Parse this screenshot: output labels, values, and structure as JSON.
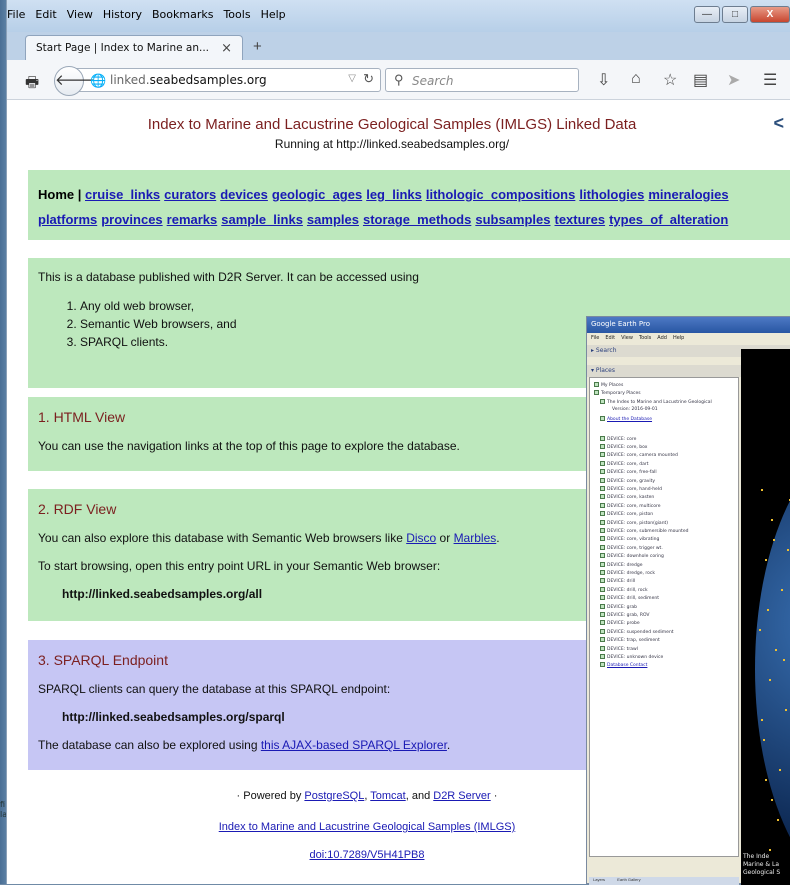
{
  "desktop": {
    "left_text_1": "fi",
    "left_text_2": "la"
  },
  "menubar": {
    "items": [
      "File",
      "Edit",
      "View",
      "History",
      "Bookmarks",
      "Tools",
      "Help"
    ],
    "accel": [
      "F",
      "E",
      "V",
      "s",
      "B",
      "T",
      "H"
    ]
  },
  "window_controls": {
    "minimize": "—",
    "maximize": "□",
    "close": "X"
  },
  "tab": {
    "label": "Start Page | Index to Marine an...",
    "close": "×",
    "new": "+"
  },
  "navbar": {
    "url_prefix": "linked.",
    "url_domain": "seabedsamples.org",
    "search_placeholder": "Search"
  },
  "icons": {
    "print": "print-icon",
    "back": "back-arrow-icon",
    "globe": "globe-icon",
    "search": "search-icon",
    "download": "download-icon",
    "home": "home-icon",
    "star": "star-icon",
    "reader": "reader-icon",
    "send": "send-icon",
    "menu": "menu-icon",
    "share": "share-icon"
  },
  "page": {
    "title": "Index to Marine and Lacustrine Geological Samples (IMLGS) Linked Data",
    "subtitle": "Running at http://linked.seabedsamples.org/",
    "nav_home": "Home",
    "nav_links": [
      "cruise_links",
      "curators",
      "devices",
      "geologic_ages",
      "leg_links",
      "lithologic_compositions",
      "lithologies",
      "mineralogies",
      "platforms",
      "provinces",
      "remarks",
      "sample_links",
      "samples",
      "storage_methods",
      "subsamples",
      "textures",
      "types_of_alteration"
    ],
    "intro_text": "This is a database published with D2R Server. It can be accessed using",
    "intro_list": [
      "Any old web browser,",
      "Semantic Web browsers, and",
      "SPARQL clients."
    ],
    "html_view": {
      "heading": "1. HTML View",
      "text": "You can use the navigation links at the top of this page to explore the database."
    },
    "rdf_view": {
      "heading": "2. RDF View",
      "text_before": "You can also explore this database with Semantic Web browsers like ",
      "link1": "Disco",
      "text_mid": " or ",
      "link2": "Marbles",
      "text_after": ".",
      "text2": "To start browsing, open this entry point URL in your Semantic Web browser:",
      "url": "http://linked.seabedsamples.org/all"
    },
    "sparql": {
      "heading": "3. SPARQL Endpoint",
      "text": "SPARQL clients can query the database at this SPARQL endpoint:",
      "url": "http://linked.seabedsamples.org/sparql",
      "text2_before": "The database can also be explored using ",
      "link": "this AJAX-based SPARQL Explorer",
      "text2_after": "."
    },
    "footer": {
      "powered_prefix": "· Powered by ",
      "pg": "PostgreSQL",
      "sep1": ", ",
      "tomcat": "Tomcat",
      "sep2": ", and ",
      "d2r": "D2R Server",
      "powered_suffix": " ·",
      "imlgs": "Index to Marine and Lacustrine Geological Samples (IMLGS)",
      "doi": "doi:10.7289/V5H41PB8"
    }
  },
  "google_earth": {
    "title": "Google Earth Pro",
    "menu": [
      "File",
      "Edit",
      "View",
      "Tools",
      "Add",
      "Help"
    ],
    "search_label": "Search",
    "places_label": "Places",
    "items": [
      "My Places",
      "Temporary Places",
      "The Index to Marine and Lacustrine Geological",
      "Version: 2016-09-01",
      "About the Database",
      "DEVICE: core",
      "DEVICE: core, box",
      "DEVICE: core, camera mounted",
      "DEVICE: core, dart",
      "DEVICE: core, free-fall",
      "DEVICE: core, gravity",
      "DEVICE: core, hand-held",
      "DEVICE: core, kasten",
      "DEVICE: core, multicore",
      "DEVICE: core, piston",
      "DEVICE: core, piston(giant)",
      "DEVICE: core, submersible mounted",
      "DEVICE: core, vibrating",
      "DEVICE: core, trigger wt.",
      "DEVICE: downhole coring",
      "DEVICE: dredge",
      "DEVICE: dredge, rock",
      "DEVICE: drill",
      "DEVICE: drill, rock",
      "DEVICE: drill, sediment",
      "DEVICE: grab",
      "DEVICE: grab, ROV",
      "DEVICE: probe",
      "DEVICE: suspended sediment",
      "DEVICE: trap, sediment",
      "DEVICE: trawl",
      "DEVICE: unknown device",
      "Database Contact"
    ],
    "caption_1": "The Inde",
    "caption_2": "Marine & La",
    "caption_3": "Geological S",
    "layers": "Layers",
    "gallery": "Earth Gallery"
  }
}
